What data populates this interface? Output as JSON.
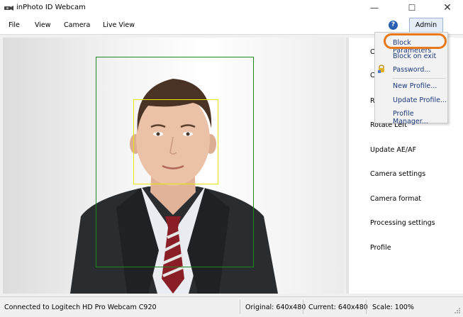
{
  "window": {
    "title": "inPhoto ID Webcam"
  },
  "window_controls": {
    "minimize": "—",
    "maximize": "☐",
    "close": "✕"
  },
  "menubar": {
    "file": "File",
    "view": "View",
    "camera": "Camera",
    "live_view": "Live View",
    "help": "?",
    "admin": "Admin"
  },
  "admin_menu": {
    "items": [
      "Block Parameters",
      "Block on exit",
      "Password...",
      "New Profile...",
      "Update Profile...",
      "Profile Manager..."
    ]
  },
  "side_panel": {
    "items": [
      "C",
      "C",
      "R",
      "Rotate Left",
      "Update AE/AF",
      "Camera settings",
      "Camera format",
      "Processing settings",
      "Profile"
    ]
  },
  "statusbar": {
    "connection": "Connected to Logitech HD Pro Webcam C920",
    "original": "Original: 640x480",
    "current": "Current: 640x480",
    "scale": "Scale: 100%"
  },
  "colors": {
    "face_frame": "#1c8a1c",
    "eye_frame": "#e8e800",
    "highlight": "#e8781a",
    "menu_text": "#1a3a7a"
  }
}
